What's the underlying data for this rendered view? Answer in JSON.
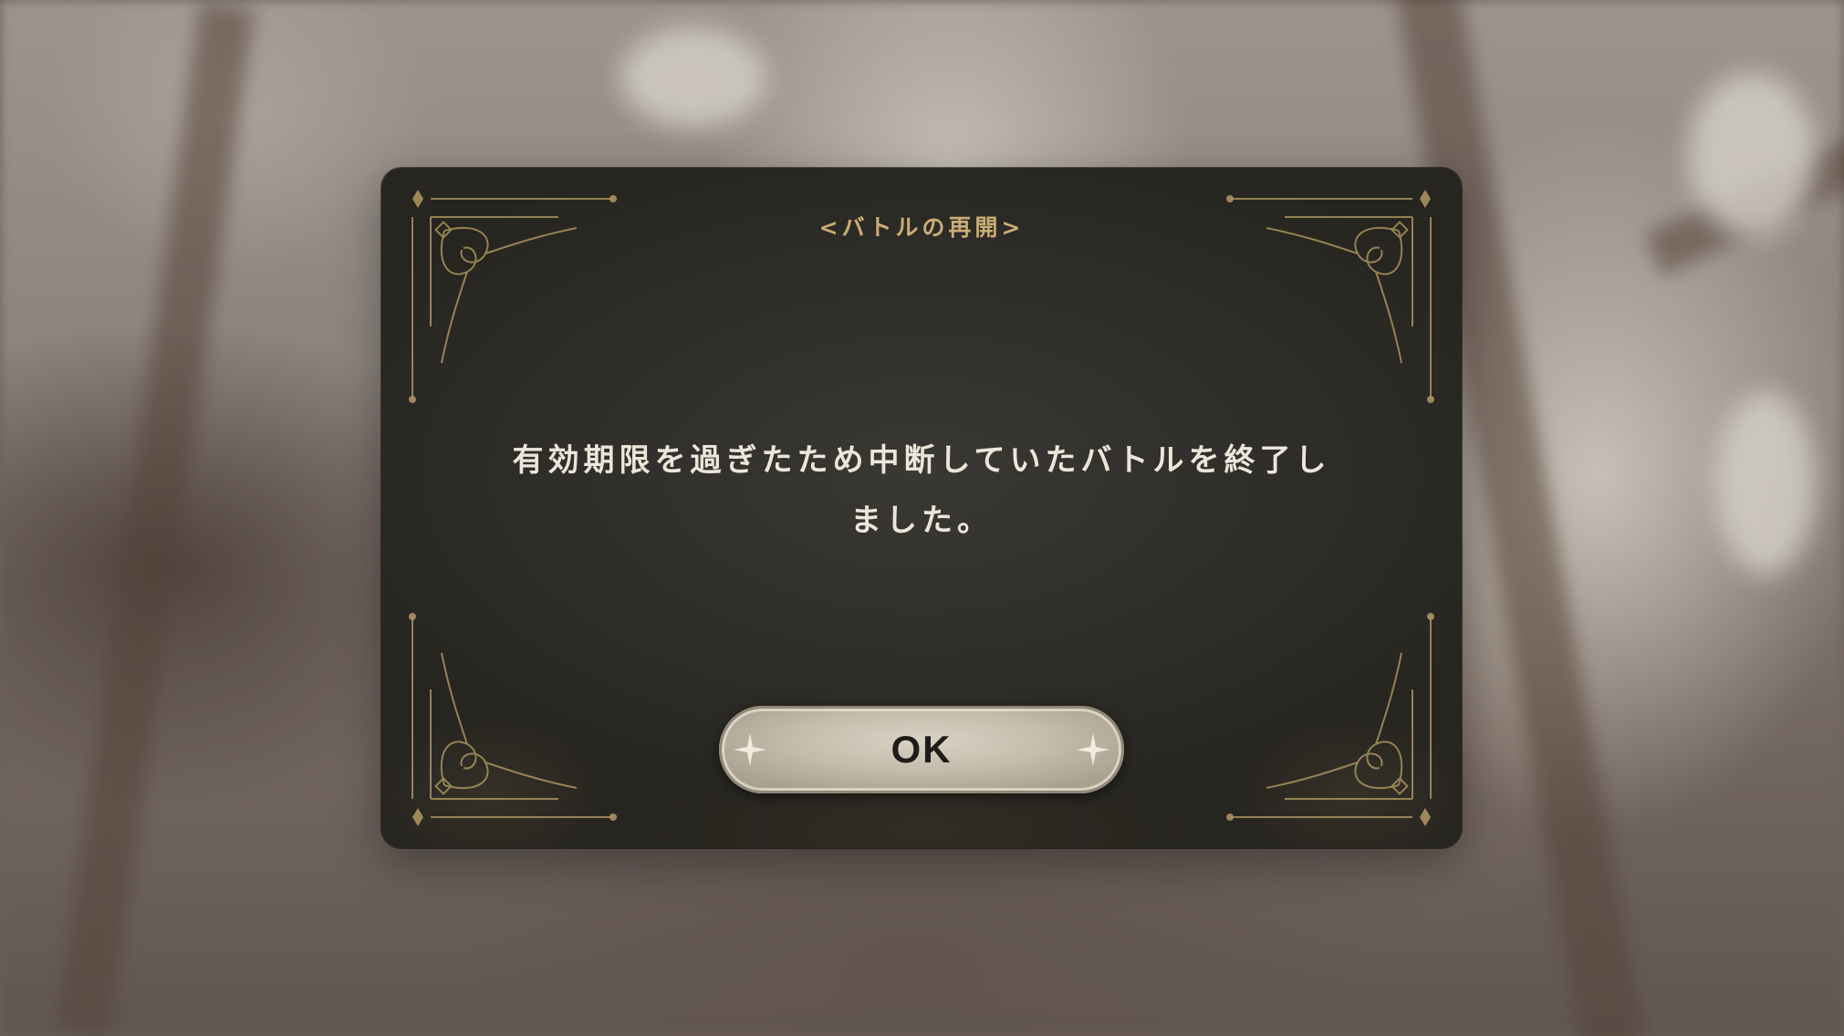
{
  "dialog": {
    "title": "<バトルの再開>",
    "message_lines": [
      "有効期限を過ぎたため中断していたバトルを終了し",
      "ました。"
    ],
    "ok_label": "OK"
  },
  "icons": {
    "corner": "ornate-corner-icon",
    "sparkle": "sparkle-icon"
  },
  "colors": {
    "dialog_bg": "#2f2d29",
    "title_gold": "#c9ad74",
    "message_text": "#ece6da",
    "button_face": "#c4bcab"
  }
}
